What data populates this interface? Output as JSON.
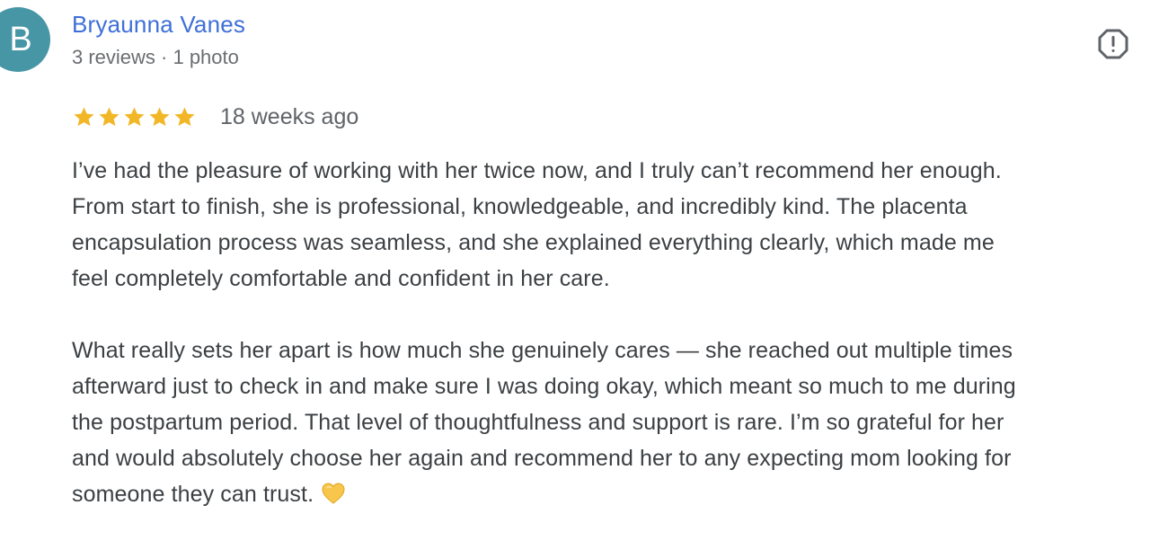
{
  "reviewer": {
    "avatar_letter": "B",
    "avatar_color": "#4796a6",
    "name": "Bryaunna Vanes",
    "meta": "3 reviews · 1 photo",
    "name_color": "#3e6fd8"
  },
  "report": {
    "icon": "report-flag-icon"
  },
  "rating": {
    "stars": 5,
    "max_stars": 5,
    "star_color": "#f2b727",
    "date": "18 weeks ago"
  },
  "review": {
    "paragraph_1": [
      "I’ve had the pleasure of working with her twice now, and I truly can’t recommend her enough.",
      "From start to finish, she is professional, knowledgeable, and incredibly kind. The placenta",
      "encapsulation process was seamless, and she explained everything clearly, which made me",
      "feel completely comfortable and confident in her care."
    ],
    "paragraph_2": [
      "What really sets her apart is how much she genuinely cares — she reached out multiple times",
      "afterward just to check in and make sure I was doing okay, which meant so much to me during",
      "the postpartum period. That level of thoughtfulness and support is rare. I’m so grateful for her",
      "and would absolutely choose her again and recommend her to any expecting mom looking for",
      "someone they can trust."
    ],
    "emoji": "yellow-heart-icon"
  }
}
